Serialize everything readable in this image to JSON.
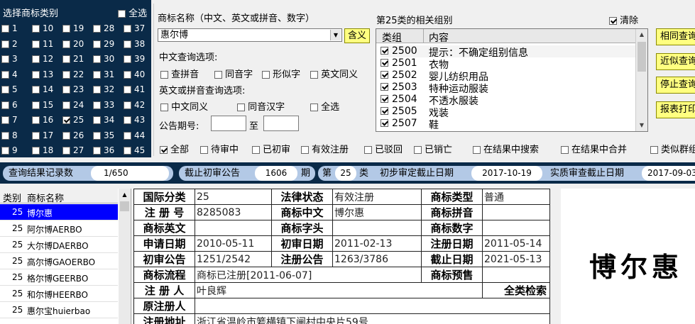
{
  "left_panel": {
    "title": "选择商标类别",
    "select_all_label": "全选",
    "categories": [
      "1",
      "2",
      "3",
      "4",
      "5",
      "6",
      "7",
      "8",
      "9",
      "10",
      "11",
      "12",
      "13",
      "14",
      "15",
      "16",
      "17",
      "18",
      "19",
      "20",
      "21",
      "22",
      "23",
      "24",
      "25",
      "26",
      "27",
      "28",
      "29",
      "30",
      "31",
      "32",
      "33",
      "34",
      "35",
      "36",
      "37",
      "38",
      "39",
      "40",
      "41",
      "42",
      "43",
      "44",
      "45"
    ],
    "checked": [
      "25"
    ]
  },
  "name_panel": {
    "label": "商标名称（中文、英文或拼音、数字）",
    "value": "惠尔博",
    "meaning_button": "含义",
    "cn_options_label": "中文查询选项:",
    "cn_options": [
      "查拼音",
      "同音字",
      "形似字",
      "英文同义"
    ],
    "en_options_label": "英文或拼音查询选项:",
    "en_options": [
      "中文同义",
      "同音汉字",
      "全选"
    ],
    "issue_label": "公告期号:",
    "to_label": "至",
    "issue_from": "",
    "issue_to": ""
  },
  "group_panel": {
    "title": "第25类的相关组别",
    "clear_label": "清除",
    "col_group": "类组",
    "col_content": "内容",
    "rows": [
      {
        "code": "2500",
        "text": "提示：不确定组别信息"
      },
      {
        "code": "2501",
        "text": "衣物"
      },
      {
        "code": "2502",
        "text": "婴儿纺织用品"
      },
      {
        "code": "2503",
        "text": "特种运动服装"
      },
      {
        "code": "2504",
        "text": "不透水服装"
      },
      {
        "code": "2505",
        "text": "戏装"
      },
      {
        "code": "2507",
        "text": "鞋"
      }
    ]
  },
  "right_buttons": [
    "相同查询",
    "近似查询",
    "停止查询",
    "报表打印"
  ],
  "options_row": [
    "全部",
    "待审中",
    "已初审",
    "有效注册",
    "已驳回",
    "已销亡",
    "在结果中搜索",
    "在结果中合并",
    "类似群组"
  ],
  "status_bar": {
    "records_label": "查询结果记录数",
    "records_value": "1/650",
    "cutoff_label": "截止初审公告",
    "cutoff_value": "1606",
    "cutoff_unit": "期",
    "class_prefix": "第",
    "class_value": "25",
    "class_suffix": "类",
    "prelim_label": "初步审定截止日期",
    "prelim_value": "2017-10-19",
    "exam_label": "实质审查截止日期",
    "exam_value": "2017-09-03"
  },
  "result_list": {
    "col_class": "类别",
    "col_name": "商标名称",
    "rows": [
      {
        "cls": "25",
        "name": "博尔惠"
      },
      {
        "cls": "25",
        "name": "阿尔博AERBO"
      },
      {
        "cls": "25",
        "name": "大尔博DAERBO"
      },
      {
        "cls": "25",
        "name": "高尔博GAOERBO"
      },
      {
        "cls": "25",
        "name": "格尔博GEERBO"
      },
      {
        "cls": "25",
        "name": "和尔博HEERBO"
      },
      {
        "cls": "25",
        "name": "惠尔宝huierbao"
      }
    ]
  },
  "detail": {
    "intl_class_label": "国际分类",
    "intl_class": "25",
    "legal_status_label": "法律状态",
    "legal_status": "有效注册",
    "tm_type_label": "商标类型",
    "tm_type": "普通",
    "reg_no_label": "注 册 号",
    "reg_no": "8285083",
    "tm_cn_label": "商标中文",
    "tm_cn": "博尔惠",
    "tm_pinyin_label": "商标拼音",
    "tm_pinyin": "",
    "tm_en_label": "商标英文",
    "tm_en": "",
    "tm_head_label": "商标字头",
    "tm_head": "",
    "tm_digits_label": "商标数字",
    "tm_digits": "",
    "apply_date_label": "申请日期",
    "apply_date": "2010-05-11",
    "prelim_date_label": "初审日期",
    "prelim_date": "2011-02-13",
    "reg_date_label": "注册日期",
    "reg_date": "2011-05-14",
    "prelim_ann_label": "初审公告",
    "prelim_ann": "1251/2542",
    "reg_ann_label": "注册公告",
    "reg_ann": "1263/3786",
    "expiry_label": "截止日期",
    "expiry": "2021-05-13",
    "flow_label": "商标流程",
    "flow": "商标已注册[2011-06-07]",
    "warn_label": "商标预售",
    "warn": "",
    "registrant_label": "注 册 人",
    "registrant": "叶良辉",
    "full_search_label": "全类检索",
    "orig_registrant_label": "原注册人",
    "orig_registrant": "",
    "address_label": "注册地址",
    "address": "浙江省温岭市箬横镇下闸村中央片59号"
  },
  "image_text": "博尔惠",
  "colors": {
    "dark_panel": "#0a2a48",
    "selected_row": "#0000ff",
    "button_yellow": "#ffff80",
    "pill": "#b3c9e6"
  }
}
